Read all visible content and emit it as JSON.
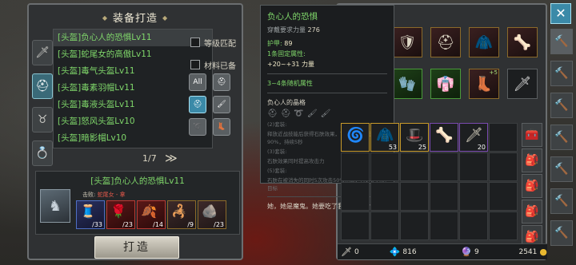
{
  "forge": {
    "title": "装备打造",
    "tabs": [
      {
        "name": "weapon",
        "icon": "sword-icon"
      },
      {
        "name": "helmet",
        "icon": "helmet-icon",
        "active": true
      },
      {
        "name": "necklace",
        "icon": "necklace-icon"
      },
      {
        "name": "ring",
        "icon": "ring-icon"
      }
    ],
    "recipes": [
      "[头盔]负心人的恐惧Lv11",
      "[头盔]蛇尾女的高傲Lv11",
      "[头盔]毒气头盔Lv11",
      "[头盔]毒素羽帽Lv11",
      "[头盔]毒液头盔Lv11",
      "[头盔]怒风头盔Lv10",
      "[头盔]暗影帽Lv10"
    ],
    "filters": {
      "level_match": "等级匹配",
      "materials_ready": "材料已备"
    },
    "filter_icons": [
      "All",
      "⛑",
      "⛑",
      "🖌",
      "➰",
      "👢"
    ],
    "pager": "1/7",
    "pager_next": "≫",
    "selected": {
      "title": "[头盔]负心人的恐惧Lv11",
      "kill_label": "击败:",
      "kill_target": "蛇尾女 - 拿",
      "materials": [
        {
          "count": "/33",
          "color": "blue"
        },
        {
          "count": "/23",
          "color": "red"
        },
        {
          "count": "/14",
          "color": "red"
        },
        {
          "count": "/9",
          "color": "gold"
        },
        {
          "count": "/23",
          "color": "gold"
        }
      ]
    },
    "button": "打造"
  },
  "tooltip": {
    "name": "负心人的恐惧",
    "req_label": "穿戴要求力量",
    "req_value": "276",
    "armor_label": "护甲:",
    "armor_value": "89",
    "fixed": "1条固定属性:",
    "range": "+20~+31 力量",
    "random": "3~4条随机属性",
    "set_name": "负心人的晶格",
    "set_icons": [
      "⛑",
      "⛑",
      "➰",
      "🖌",
      "🖌"
    ],
    "set_lines": [
      "(2)套装:",
      "  释放近战技能后获得石肤效果，下次受到的伤害减少90%，持续5秒",
      "(3)套装:",
      "  石肤效果同时提高攻击力",
      "(5)套装:",
      "  石肤在被消失的同时5次攻击50%伤害，且必定石化目标"
    ],
    "flavor": "她，她是魔鬼。她要吃了我，不，救命"
  },
  "inventory": {
    "cells": [
      {
        "glyph": "🌀",
        "count": "",
        "type": "gold"
      },
      {
        "glyph": "🧥",
        "count": "53",
        "type": "gold"
      },
      {
        "glyph": "🎩",
        "count": "25",
        "type": "gold"
      },
      {
        "glyph": "🦴",
        "count": "",
        "type": "purple"
      },
      {
        "glyph": "🗡",
        "count": "20",
        "type": "purple"
      },
      {
        "glyph": "",
        "count": "",
        "type": ""
      }
    ]
  },
  "bottom": {
    "sword_val": "0",
    "gem_val": "816",
    "stone_val": "9",
    "gold_val": "2541"
  },
  "close_label": "✕",
  "side_icons": [
    "🔨",
    "🔨",
    "🔨",
    "🔨",
    "🔨",
    "🔨",
    "🔨"
  ]
}
